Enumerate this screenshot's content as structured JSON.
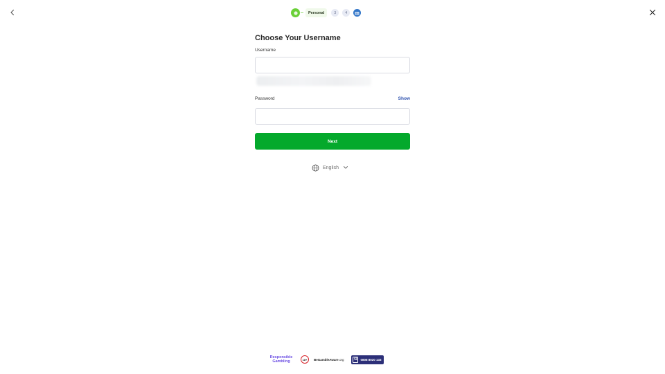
{
  "header": {
    "back_icon": "chevron-left-icon",
    "close_icon": "close-icon"
  },
  "stepper": {
    "current_step_label": "Personal",
    "step_3": "3",
    "step_4": "4",
    "final_icon": "gift-icon",
    "colors": {
      "done": "#6ad037",
      "pending": "#e7eaf4",
      "final": "#3276c8"
    }
  },
  "form": {
    "title": "Choose Your Username",
    "username_label": "Username",
    "username_value": "",
    "password_label": "Password",
    "password_value": "",
    "show_label": "Show",
    "next_label": "Next",
    "next_color": "#04a92c"
  },
  "language": {
    "icon": "globe-icon",
    "selected": "English",
    "chevron": "chevron-down-icon"
  },
  "footer": {
    "responsible_gambling": "Responsible Gambling",
    "age_badge": "18+",
    "be_gamble_aware": "BeGambleAware",
    "be_gamble_aware_suffix": ".org",
    "gambleaware_letter": "G",
    "helpline": "0808 8020 133"
  }
}
